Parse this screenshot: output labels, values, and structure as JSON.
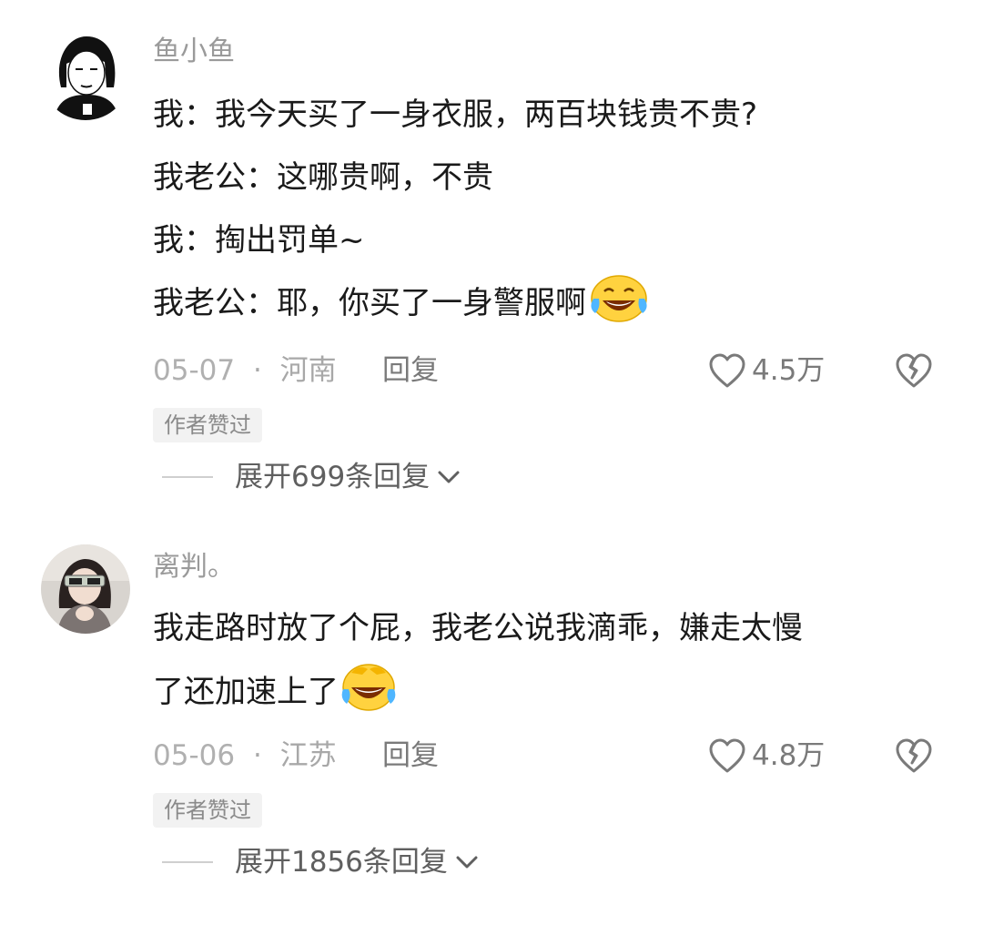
{
  "comments": [
    {
      "username": "鱼小鱼",
      "lines": [
        "我：我今天买了一身衣服，两百块钱贵不贵?",
        "我老公：这哪贵啊，不贵",
        "我：掏出罚单~",
        "我老公：耶，你买了一身警服啊"
      ],
      "emoji": "laughing-tears-icon",
      "date": "05-07",
      "separator": "·",
      "location": "河南",
      "reply_label": "回复",
      "likes": "4.5万",
      "badge": "作者赞过",
      "expand_label": "展开699条回复"
    },
    {
      "username": "离判。",
      "lines": [
        "我走路时放了个屁，我老公说我滴乖，嫌走太慢",
        "了还加速上了"
      ],
      "emoji": "crying-laugh-cover-face-icon",
      "date": "05-06",
      "separator": "·",
      "location": "江苏",
      "reply_label": "回复",
      "likes": "4.8万",
      "badge": "作者赞过",
      "expand_label": "展开1856条回复"
    }
  ],
  "colors": {
    "text": "#1a1a1a",
    "meta": "#a8a8a8",
    "username": "#9a9a9a",
    "badge_bg": "#f2f2f2"
  }
}
